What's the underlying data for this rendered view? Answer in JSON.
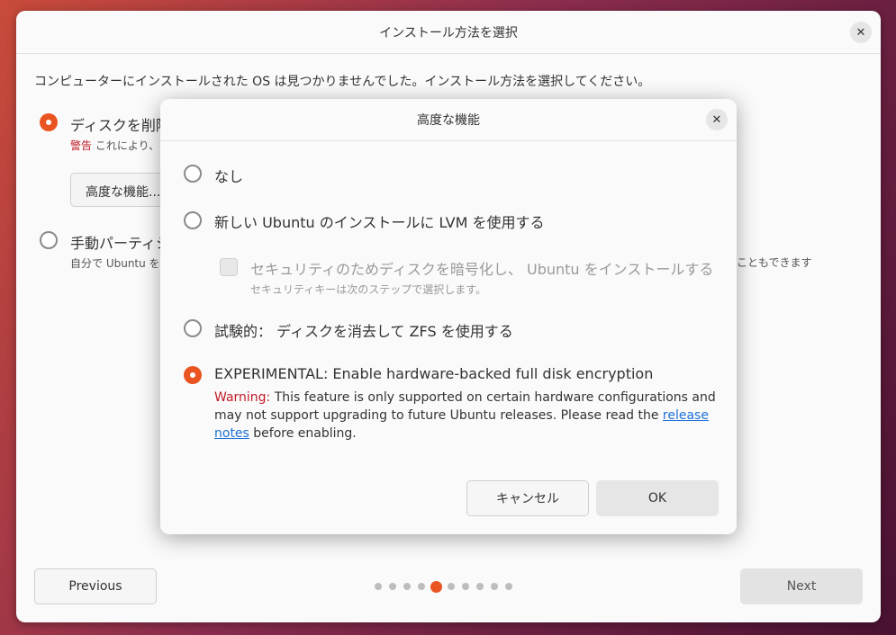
{
  "window": {
    "title": "インストール方法を選択",
    "intro": "コンピューターにインストールされた OS は見つかりませんでした。インストール方法を選択してください。",
    "option1_label": "ディスクを削除",
    "option1_warn_label": "警告",
    "option1_warn_text": "これにより、",
    "advanced_button": "高度な機能...",
    "option2_label": "手動パーティション",
    "option2_sub_left": "自分で Ubuntu を",
    "option2_sub_right": "こともできます",
    "previous": "Previous",
    "next": "Next",
    "pager": {
      "total": 10,
      "active": 5
    }
  },
  "dialog": {
    "title": "高度な機能",
    "options": [
      {
        "label": "なし",
        "checked": false
      },
      {
        "label": "新しい Ubuntu のインストールに LVM を使用する",
        "checked": false
      },
      {
        "label": "試験的： ディスクを消去して ZFS を使用する",
        "checked": false
      },
      {
        "label": "EXPERIMENTAL: Enable hardware-backed full disk encryption",
        "checked": true
      }
    ],
    "encrypt_checkbox_label": "セキュリティのためディスクを暗号化し、 Ubuntu をインストールする",
    "encrypt_checkbox_sub": "セキュリティキーは次のステップで選択します。",
    "warning_label": "Warning:",
    "warning_text": " This feature is only supported on certain hardware configurations and may not support upgrading to future Ubuntu releases. Please read the ",
    "warning_link": "release notes",
    "warning_tail": " before enabling.",
    "cancel": "キャンセル",
    "ok": "OK"
  },
  "colors": {
    "accent": "#e95420",
    "warning": "#c01c28",
    "link": "#1c71d8"
  },
  "icons": {
    "close": "close-icon"
  }
}
